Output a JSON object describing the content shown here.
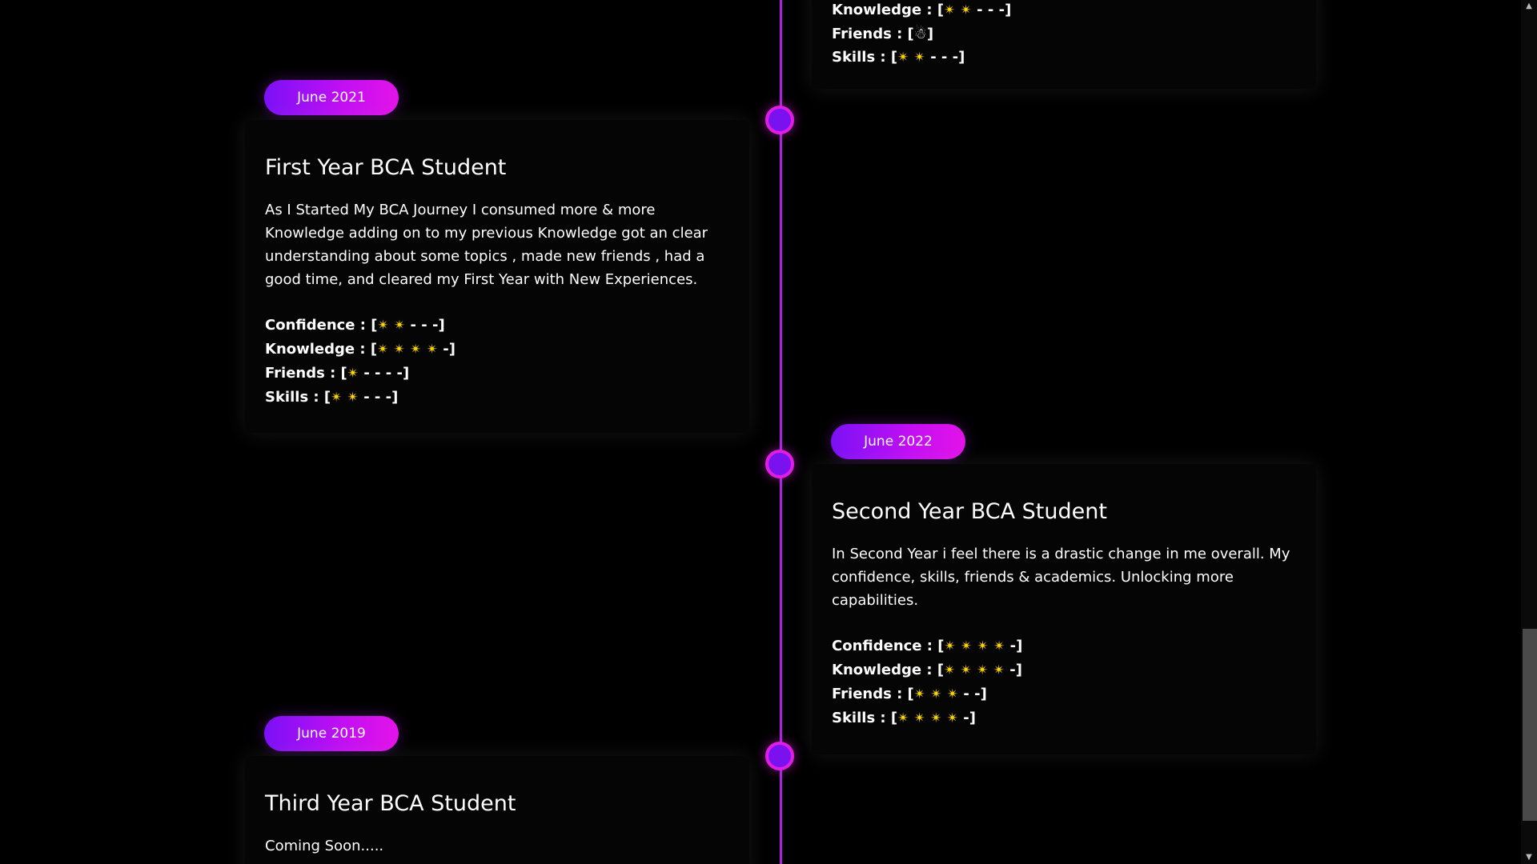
{
  "star_glyph": "✴",
  "friend_glyph": "☃",
  "colors": {
    "background": "#000000",
    "timeline": "#b01ee6",
    "pill_start": "#7b10f6",
    "pill_end": "#e313e8",
    "star": "#ffd800"
  },
  "top_card": {
    "stats": [
      {
        "label": "Knowledge : ",
        "open": "[",
        "stars": 2,
        "dashes": "- - -",
        "close": "]"
      },
      {
        "label": "Friends : ",
        "open": "[",
        "icon": "snowman",
        "close": "]"
      },
      {
        "label": "Skills : ",
        "open": "[",
        "stars": 2,
        "dashes": "- - -",
        "close": "]"
      }
    ]
  },
  "entries": [
    {
      "date": "June 2021",
      "title": "First Year BCA Student",
      "description": "As I Started My BCA Journey I consumed more & more Knowledge adding on to my previous Knowledge got an clear understanding about some topics , made new friends , had a good time, and cleared my First Year with New Experiences.",
      "stats": [
        {
          "label": "Confidence : ",
          "stars": 2,
          "dashes": "- - -"
        },
        {
          "label": "Knowledge : ",
          "stars": 4,
          "dashes": "-"
        },
        {
          "label": "Friends : ",
          "stars": 1,
          "dashes": "- - - -"
        },
        {
          "label": "Skills : ",
          "stars": 2,
          "dashes": "- - -"
        }
      ]
    },
    {
      "date": "June 2022",
      "title": "Second Year BCA Student",
      "description": "In Second Year i feel there is a drastic change in me overall. My confidence, skills, friends & academics. Unlocking more capabilities.",
      "stats": [
        {
          "label": "Confidence : ",
          "stars": 4,
          "dashes": "-"
        },
        {
          "label": "Knowledge : ",
          "stars": 4,
          "dashes": "-"
        },
        {
          "label": "Friends : ",
          "stars": 3,
          "dashes": "- -"
        },
        {
          "label": "Skills : ",
          "stars": 4,
          "dashes": "-"
        }
      ]
    },
    {
      "date": "June 2019",
      "title": "Third Year BCA Student",
      "description": "Coming Soon....."
    }
  ]
}
